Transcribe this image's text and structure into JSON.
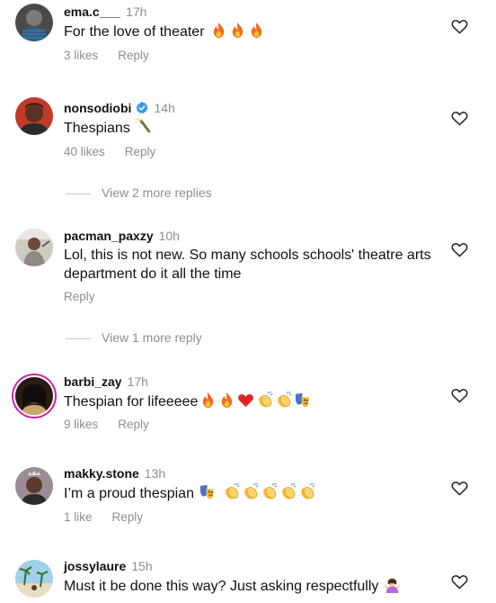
{
  "colors": {
    "text": "#111111",
    "muted": "#8e8e8e",
    "verified": "#3897f0",
    "story_ring": "#d6249f",
    "fire": "#f36a1d",
    "heart_red": "#e02424",
    "clap": "#f6b93b"
  },
  "comments": [
    {
      "username": "ema.c___",
      "time": "17h",
      "text": "For the love of theater",
      "emoji": [
        "fire-icon",
        "fire-icon",
        "fire-icon"
      ],
      "likes": "3 likes",
      "reply": "Reply"
    },
    {
      "username": "nonsodiobi",
      "verified": true,
      "time": "14h",
      "text": "Thespians",
      "emoji": [
        "champagne-icon"
      ],
      "likes": "40 likes",
      "reply": "Reply",
      "more_replies": "View 2 more replies"
    },
    {
      "username": "pacman_paxzy",
      "time": "10h",
      "text": "Lol, this is not new. So many schools schools' theatre arts department do it all the time",
      "reply": "Reply",
      "more_replies": "View 1 more reply"
    },
    {
      "username": "barbi_zay",
      "time": "17h",
      "text": "Thespian for lifeeeee",
      "emoji": [
        "fire-icon",
        "fire-icon",
        "red-heart-icon",
        "clapping-hands-icon",
        "clapping-hands-icon",
        "theater-masks-icon"
      ],
      "likes": "9 likes",
      "reply": "Reply"
    },
    {
      "username": "makky.stone",
      "time": "13h",
      "text": "I’m a proud thespian",
      "emoji": [
        "theater-masks-icon",
        "clapping-hands-icon",
        "clapping-hands-icon",
        "clapping-hands-icon",
        "clapping-hands-icon",
        "clapping-hands-icon"
      ],
      "likes": "1 like",
      "reply": "Reply"
    },
    {
      "username": "jossylaure",
      "time": "15h",
      "text": "Must it be done this way? Just asking respectfully",
      "emoji": [
        "woman-shrugging-icon"
      ]
    }
  ]
}
